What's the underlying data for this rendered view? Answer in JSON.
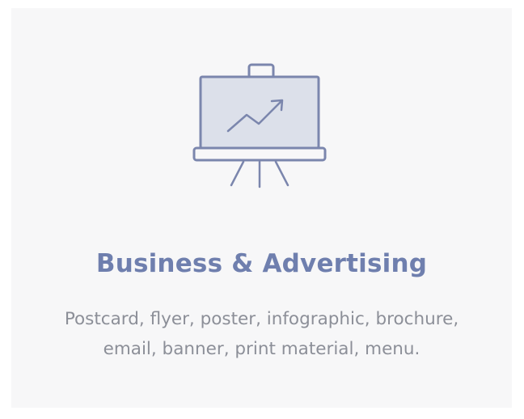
{
  "card": {
    "icon": "presentation-easel-chart-icon",
    "title": "Business & Advertising",
    "description": "Postcard, flyer, poster, infographic, brochure, email, banner, print material, menu."
  },
  "colors": {
    "card_background": "#f7f7f8",
    "title": "#6f7fae",
    "description": "#8c8f98",
    "icon_stroke": "#7b86ad",
    "icon_fill": "#dce0ea"
  }
}
